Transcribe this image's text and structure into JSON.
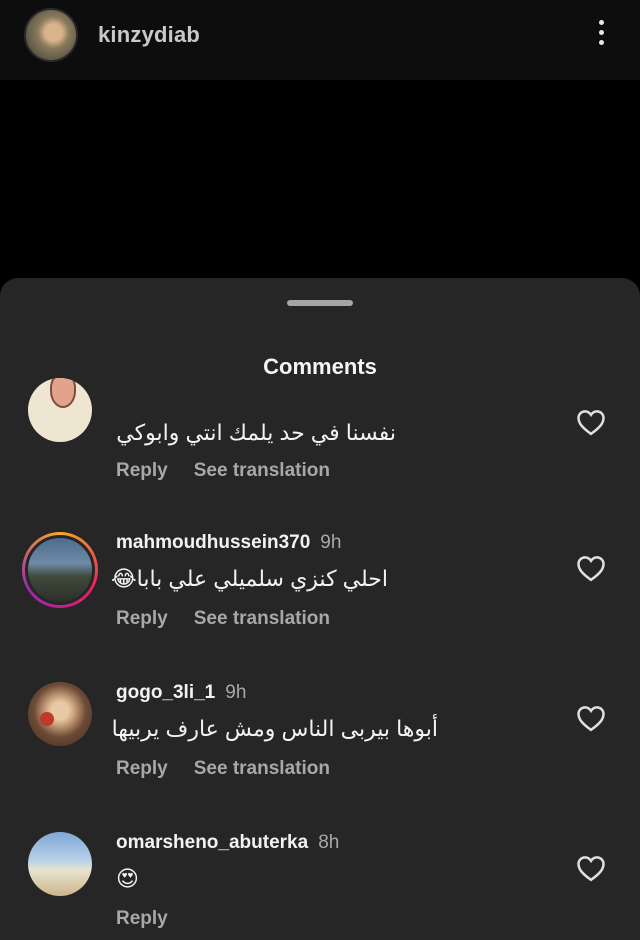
{
  "header": {
    "username": "kinzydiab",
    "more_icon": "more-vertical-icon"
  },
  "sheet": {
    "title": "Comments"
  },
  "comments": [
    {
      "username": "",
      "time": "",
      "text": "نفسنا في حد يلمك انتي وابوكي",
      "reply_label": "Reply",
      "translate_label": "See translation",
      "avatar": "cartoon-avatar",
      "liked": false
    },
    {
      "username": "mahmoudhussein370",
      "time": "9h",
      "text": "احلي كنزي سلميلي علي بابا😂",
      "reply_label": "Reply",
      "translate_label": "See translation",
      "avatar": "story-ring-avatar",
      "liked": false
    },
    {
      "username": "gogo_3li_1",
      "time": "9h",
      "text": "أبوها بيربى الناس ومش عارف يربيها",
      "reply_label": "Reply",
      "translate_label": "See translation",
      "avatar": "portrait-avatar",
      "liked": false
    },
    {
      "username": "omarsheno_abuterka",
      "time": "8h",
      "text": "😍",
      "reply_label": "Reply",
      "translate_label": "",
      "avatar": "beach-avatar",
      "liked": false
    }
  ],
  "colors": {
    "background": "#000000",
    "sheet": "#262626",
    "muted_text": "#a8a8a8",
    "primary_text": "#f2f2f2"
  }
}
